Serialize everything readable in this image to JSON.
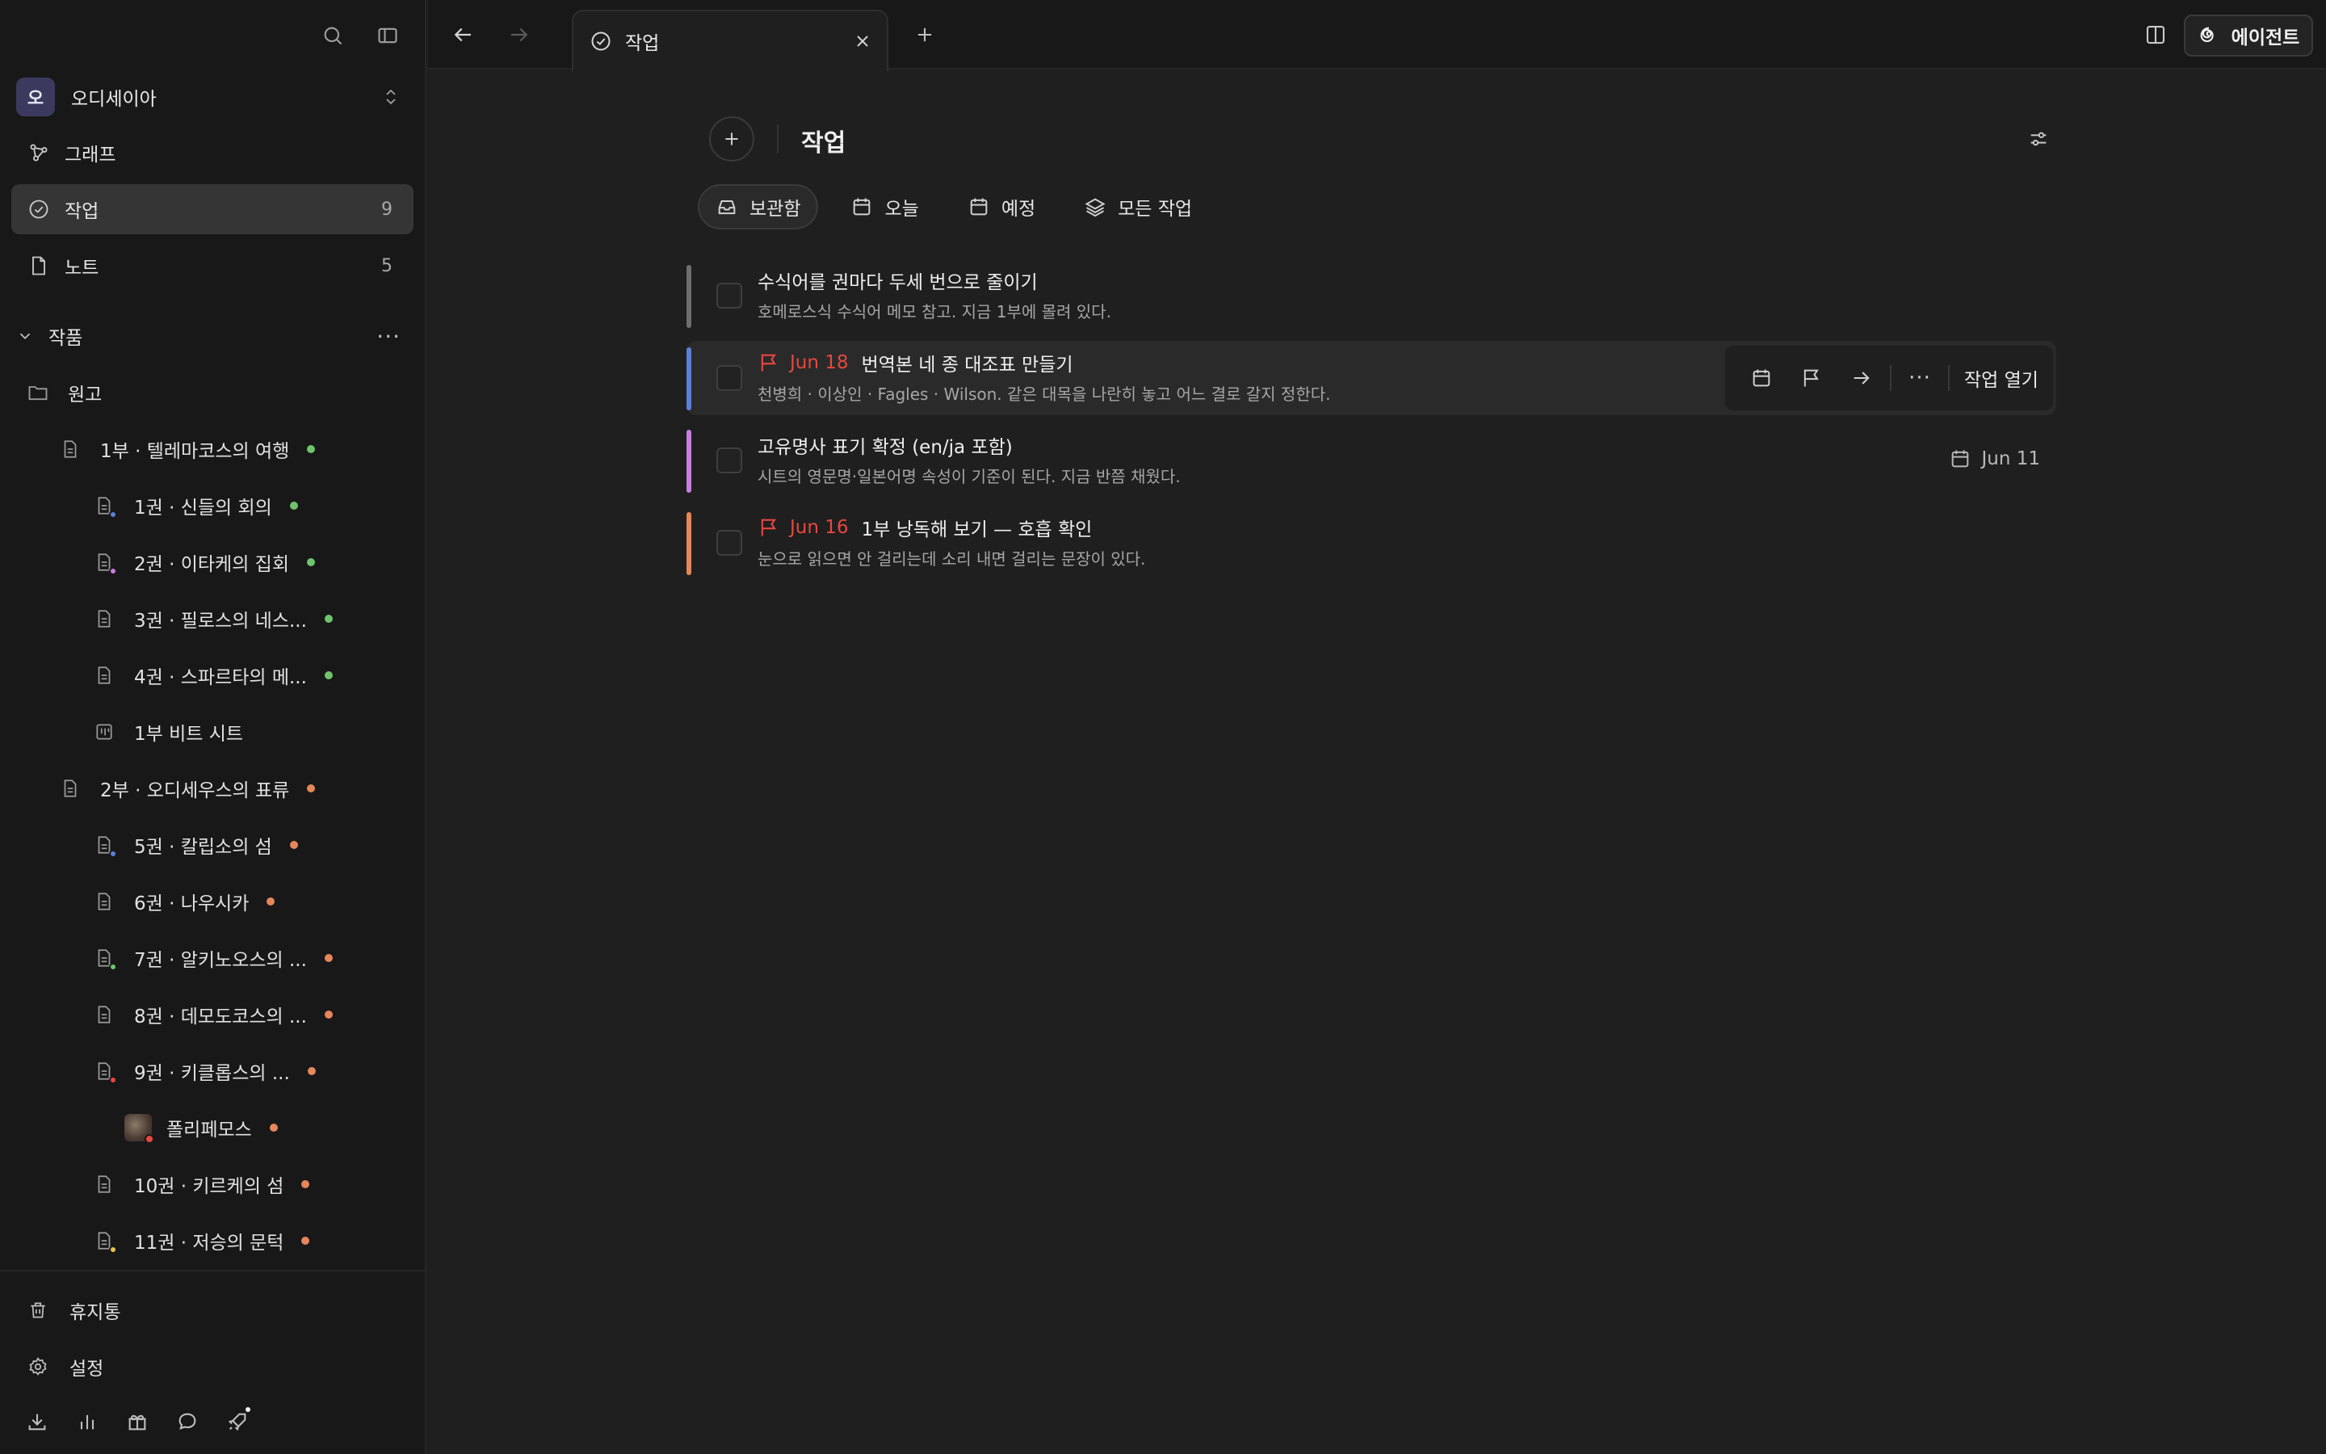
{
  "colors": {
    "accent_red": "#e5483f",
    "status_green": "#6ec46b",
    "status_orange": "#e5875a",
    "bar_gray": "#6e6e6e",
    "bar_blue": "#5b7fd6",
    "bar_purple": "#c77ee0",
    "bar_orange": "#e5875a"
  },
  "sidebar": {
    "workspace": {
      "avatar_letter": "오",
      "name": "오디세이아"
    },
    "nav": [
      {
        "label": "그래프",
        "icon": "graph-icon",
        "count": ""
      },
      {
        "label": "작업",
        "icon": "check-circle-icon",
        "count": "9"
      },
      {
        "label": "노트",
        "icon": "note-icon",
        "count": "5"
      }
    ],
    "section": {
      "label": "작품"
    },
    "tree": [
      {
        "label": "원고",
        "icon": "folder-icon"
      },
      {
        "label": "1부 · 텔레마코스의 여행",
        "icon": "document-icon",
        "status": "green"
      },
      {
        "label": "1권 · 신들의 회의",
        "icon": "document-icon",
        "status": "green",
        "sub": "blue"
      },
      {
        "label": "2권 · 이타케의 집회",
        "icon": "document-icon",
        "status": "green",
        "sub": "purple"
      },
      {
        "label": "3권 · 필로스의 네스...",
        "icon": "document-icon",
        "status": "green"
      },
      {
        "label": "4권 · 스파르타의 메...",
        "icon": "document-icon",
        "status": "green"
      },
      {
        "label": "1부 비트 시트",
        "icon": "board-icon"
      },
      {
        "label": "2부 · 오디세우스의 표류",
        "icon": "document-icon",
        "status": "orange"
      },
      {
        "label": "5권 · 칼립소의 섬",
        "icon": "document-icon",
        "status": "orange",
        "sub": "blue"
      },
      {
        "label": "6권 · 나우시카",
        "icon": "document-icon",
        "status": "orange"
      },
      {
        "label": "7권 · 알키노오스의 ...",
        "icon": "document-icon",
        "status": "orange",
        "sub": "green"
      },
      {
        "label": "8권 · 데모도코스의 ...",
        "icon": "document-icon",
        "status": "orange"
      },
      {
        "label": "9권 · 키클롭스의 ...",
        "icon": "document-icon",
        "status": "orange",
        "sub": "red"
      },
      {
        "label": "폴리페모스",
        "icon": "image-thumbnail",
        "status": "orange",
        "sub": "red"
      },
      {
        "label": "10권 · 키르케의 섬",
        "icon": "document-icon",
        "status": "orange"
      },
      {
        "label": "11권 · 저승의 문턱",
        "icon": "document-icon",
        "status": "orange",
        "sub": "yellow"
      }
    ],
    "bottom": [
      {
        "label": "휴지통",
        "icon": "trash-icon"
      },
      {
        "label": "설정",
        "icon": "gear-icon"
      }
    ]
  },
  "topbar": {
    "tab_label": "작업",
    "agent_label": "에이전트"
  },
  "main": {
    "title": "작업",
    "filters": [
      {
        "label": "보관함",
        "icon": "inbox-icon",
        "active": true
      },
      {
        "label": "오늘",
        "icon": "calendar-icon"
      },
      {
        "label": "예정",
        "icon": "calendar-icon"
      },
      {
        "label": "모든 작업",
        "icon": "layers-icon"
      }
    ],
    "tasks": [
      {
        "title": "수식어를 권마다 두세 번으로 줄이기",
        "subtitle": "호메로스식 수식어 메모 참고. 지금 1부에 몰려 있다.",
        "due": "",
        "right_date": ""
      },
      {
        "title": "번역본 네 종 대조표 만들기",
        "subtitle": "천병희 · 이상인 · Fagles · Wilson. 같은 대목을 나란히 놓고 어느 결로 갈지 정한다.",
        "due": "Jun 18",
        "right_date": ""
      },
      {
        "title": "고유명사 표기 확정 (en/ja 포함)",
        "subtitle": "시트의 영문명·일본어명 속성이 기준이 된다. 지금 반쯤 채웠다.",
        "due": "",
        "right_date": "Jun 11"
      },
      {
        "title": "1부 낭독해 보기 — 호흡 확인",
        "subtitle": "눈으로 읽으면 안 걸리는데 소리 내면 걸리는 문장이 있다.",
        "due": "Jun 16",
        "right_date": ""
      }
    ],
    "hover_actions": {
      "open_label": "작업 열기"
    }
  }
}
